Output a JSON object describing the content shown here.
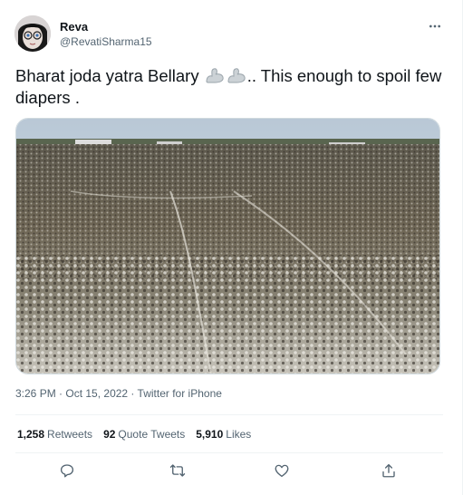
{
  "user": {
    "display_name": "Reva",
    "handle": "@RevatiSharma15",
    "avatar_icon": "woman-with-glasses-avatar"
  },
  "tweet": {
    "text_before": "Bharat joda yatra Bellary ",
    "emojis": [
      "flexed-biceps-emoji",
      "flexed-biceps-emoji"
    ],
    "text_after": ".. This enough to spoil few diapers .",
    "media_description_icon": "crowd-photo"
  },
  "meta": {
    "time": "3:26 PM",
    "sep1": " · ",
    "date": "Oct 15, 2022",
    "sep2": " · ",
    "source": "Twitter for iPhone"
  },
  "stats": {
    "retweets_count": "1,258",
    "retweets_label": "Retweets",
    "quotes_count": "92",
    "quotes_label": "Quote Tweets",
    "likes_count": "5,910",
    "likes_label": "Likes"
  },
  "actions": {
    "icons": [
      "reply-icon",
      "retweet-icon",
      "like-icon",
      "share-icon"
    ]
  },
  "colors": {
    "text": "#0f1419",
    "secondary": "#536471",
    "border": "#eff3f4"
  }
}
